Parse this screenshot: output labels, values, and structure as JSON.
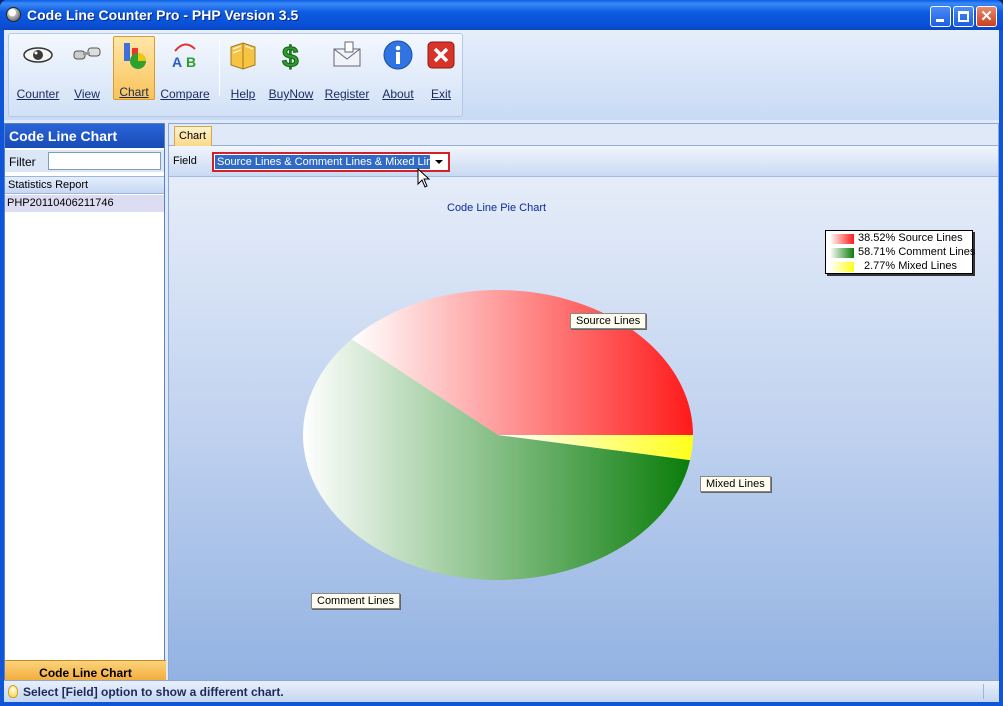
{
  "window": {
    "title": "Code Line Counter Pro - PHP Version 3.5"
  },
  "toolbar": {
    "buttons": [
      {
        "label": "Counter",
        "icon": "eye-icon"
      },
      {
        "label": "View",
        "icon": "binoculars-icon"
      },
      {
        "label": "Chart",
        "icon": "chart-icon",
        "active": true
      },
      {
        "label": "Compare",
        "icon": "compare-ab-icon"
      },
      {
        "label": "Help",
        "icon": "book-icon"
      },
      {
        "label": "BuyNow",
        "icon": "dollar-icon"
      },
      {
        "label": "Register",
        "icon": "envelope-icon"
      },
      {
        "label": "About",
        "icon": "info-icon"
      },
      {
        "label": "Exit",
        "icon": "close-x-icon"
      }
    ]
  },
  "left_pane": {
    "title": "Code Line Chart",
    "filter_label": "Filter",
    "filter_value": "",
    "list_header": "Statistics Report",
    "items": [
      "PHP20110406211746"
    ],
    "footer": "Code Line Chart"
  },
  "right_pane": {
    "tab": "Chart",
    "field_label": "Field",
    "field_value": "Source Lines & Comment Lines & Mixed Lines"
  },
  "chart_data": {
    "type": "pie",
    "title": "Code Line Pie Chart",
    "categories": [
      "Source Lines",
      "Comment Lines",
      "Mixed Lines"
    ],
    "values": [
      38.52,
      58.71,
      2.77
    ],
    "colors": [
      "#ff1a1a",
      "#0a7d0a",
      "#ffff1a"
    ],
    "legend": [
      "38.52% Source Lines",
      "58.71% Comment Lines",
      "2.77% Mixed Lines"
    ],
    "legend_position": "top-right"
  },
  "status": {
    "text": "Select [Field] option to show a different chart."
  }
}
